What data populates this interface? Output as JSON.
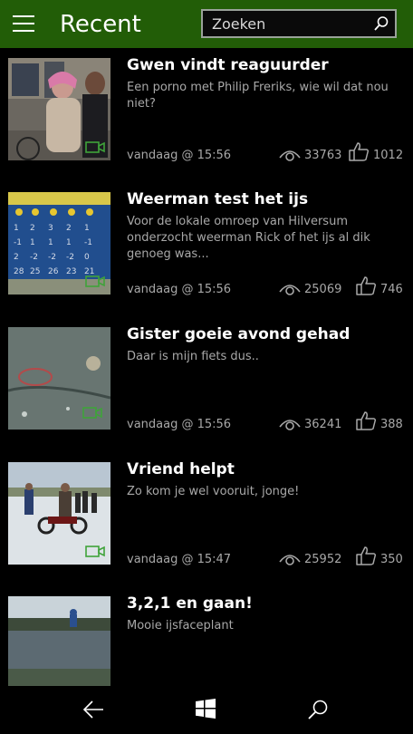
{
  "header": {
    "title": "Recent",
    "search_placeholder": "Zoeken",
    "accent_color": "#225d07"
  },
  "items": [
    {
      "title": "Gwen vindt reaguurder",
      "subtitle": "Een porno met Philip Freriks, wie wil dat nou niet?",
      "time": "vandaag @ 15:56",
      "views": "33763",
      "likes": "1012"
    },
    {
      "title": "Weerman test het ijs",
      "subtitle": "Voor de lokale omroep van Hilversum onderzocht weerman Rick of het ijs al dik genoeg was...",
      "time": "vandaag @ 15:56",
      "views": "25069",
      "likes": "746"
    },
    {
      "title": "Gister goeie avond gehad",
      "subtitle": "Daar is mijn fiets dus..",
      "time": "vandaag @ 15:56",
      "views": "36241",
      "likes": "388"
    },
    {
      "title": "Vriend helpt",
      "subtitle": "Zo kom je wel vooruit, jonge!",
      "time": "vandaag @ 15:47",
      "views": "25952",
      "likes": "350"
    },
    {
      "title": "3,2,1 en gaan!",
      "subtitle": "Mooie ijsfaceplant",
      "time": "",
      "views": "",
      "likes": ""
    }
  ],
  "icons": {
    "menu": "hamburger-menu-icon",
    "search": "search-icon",
    "views": "eye-icon",
    "likes": "thumbs-up-icon",
    "video": "video-camera-icon",
    "back": "back-arrow-icon",
    "start": "windows-logo-icon",
    "nav_search": "search-icon"
  }
}
